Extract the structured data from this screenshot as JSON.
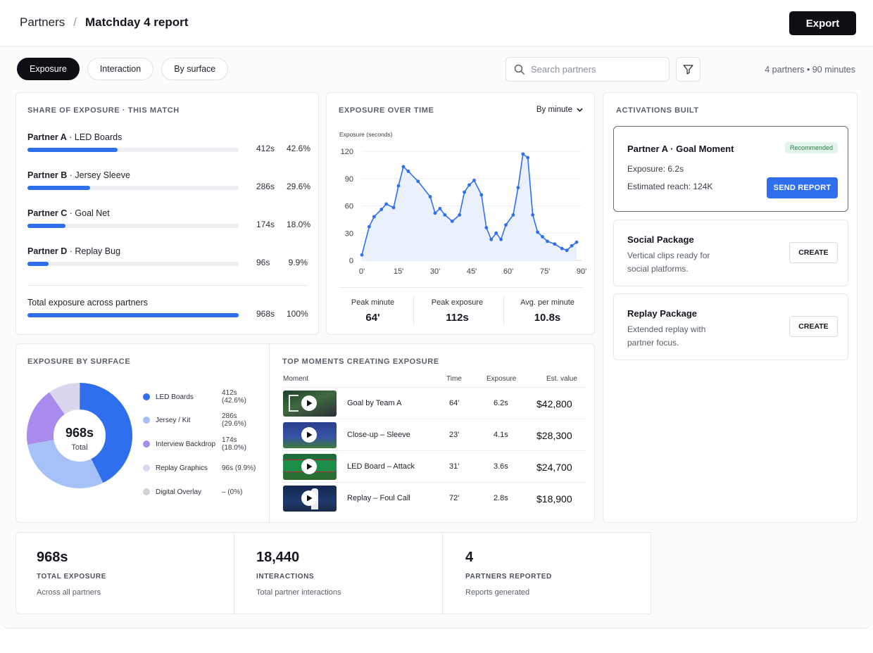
{
  "header": {
    "breadcrumb_root": "Partners",
    "breadcrumb_sep": "/",
    "breadcrumb_current": "Matchday 4 report",
    "export_label": "Export"
  },
  "toolbar": {
    "tabs": [
      {
        "label": "Exposure",
        "active": true
      },
      {
        "label": "Interaction",
        "active": false
      },
      {
        "label": "By surface",
        "active": false
      }
    ],
    "search_placeholder": "Search partners",
    "summary": "4 partners • 90 minutes"
  },
  "share": {
    "title": "Share of exposure · This match",
    "rows": [
      {
        "partner": "Partner A",
        "surface": "LED Boards",
        "seconds": "412s",
        "pct": "42.6%",
        "fraction": 0.426
      },
      {
        "partner": "Partner B",
        "surface": "Jersey Sleeve",
        "seconds": "286s",
        "pct": "29.6%",
        "fraction": 0.296
      },
      {
        "partner": "Partner C",
        "surface": "Goal Net",
        "seconds": "174s",
        "pct": "18.0%",
        "fraction": 0.18
      },
      {
        "partner": "Partner D",
        "surface": "Replay Bug",
        "seconds": "96s",
        "pct": "9.9%",
        "fraction": 0.099
      }
    ],
    "total_label": "Total exposure across partners",
    "total_seconds": "968s",
    "total_pct": "100%",
    "total_fraction": 1.0
  },
  "timeline": {
    "title": "Exposure over time",
    "granularity": "By minute",
    "stats": [
      {
        "label": "Peak minute",
        "value": "64'"
      },
      {
        "label": "Peak exposure",
        "value": "112s"
      },
      {
        "label": "Avg. per minute",
        "value": "10.8s"
      }
    ]
  },
  "chart_data": {
    "type": "area",
    "ylabel": "Exposure (seconds)",
    "xlabel": "",
    "x_ticks": [
      "0'",
      "15'",
      "30'",
      "45'",
      "60'",
      "75'",
      "90'"
    ],
    "y_ticks": [
      "0",
      "30",
      "60",
      "90",
      "120"
    ],
    "xlim": [
      0,
      90
    ],
    "ylim": [
      0,
      120
    ],
    "grid": true,
    "color": "#2f6fed",
    "fill": "#e8effd",
    "series": [
      {
        "x": [
          0,
          3,
          5,
          8,
          10,
          13,
          15,
          17,
          19,
          23,
          28,
          30,
          32,
          34,
          37,
          40,
          42,
          44,
          46,
          49,
          51,
          53,
          55,
          57,
          59,
          62,
          64,
          66,
          68,
          70,
          72,
          74,
          76,
          79,
          82,
          84,
          86,
          88
        ],
        "values": [
          6,
          37,
          48,
          56,
          62,
          58,
          82,
          103,
          98,
          87,
          70,
          52,
          57,
          50,
          43,
          50,
          75,
          83,
          88,
          72,
          36,
          23,
          30,
          23,
          39,
          50,
          80,
          117,
          113,
          50,
          31,
          26,
          21,
          18,
          13,
          11,
          16,
          20
        ]
      }
    ]
  },
  "activations": {
    "title": "Activations built",
    "featured": {
      "title": "Partner A · Goal Moment",
      "badge": "Recommended",
      "exposure": "Exposure: 6.2s",
      "reach": "Estimated reach: 124K",
      "action": "SEND REPORT"
    },
    "items": [
      {
        "title": "Social Package",
        "desc1": "Vertical clips ready for",
        "desc2": "social platforms.",
        "action": "CREATE"
      },
      {
        "title": "Replay Package",
        "desc1": "Extended replay with",
        "desc2": "partner focus.",
        "action": "CREATE"
      }
    ]
  },
  "surface": {
    "title": "Exposure by surface",
    "center_value": "968s",
    "center_label": "Total",
    "legend": [
      {
        "name": "LED Boards",
        "value": "412s (42.6%)",
        "color": "#2f6fed",
        "fraction": 0.426
      },
      {
        "name": "Jersey / Kit",
        "value": "286s (29.6%)",
        "color": "#a6c1f7",
        "fraction": 0.296
      },
      {
        "name": "Interview Backdrop",
        "value": "174s (18.0%)",
        "color": "#a88bec",
        "fraction": 0.18
      },
      {
        "name": "Replay Graphics",
        "value": "96s (9.9%)",
        "color": "#d9d6ee",
        "fraction": 0.099
      },
      {
        "name": "Digital Overlay",
        "value": "– (0%)",
        "color": "#cfd2d8",
        "fraction": 0.0
      }
    ]
  },
  "moments": {
    "title": "Top moments creating exposure",
    "columns": [
      "Moment",
      "Time",
      "Exposure",
      "Est. value"
    ],
    "rows": [
      {
        "name": "Goal by Team A",
        "time": "64'",
        "exposure": "6.2s",
        "value": "$42,800"
      },
      {
        "name": "Close-up – Sleeve",
        "time": "23'",
        "exposure": "4.1s",
        "value": "$28,300"
      },
      {
        "name": "LED Board – Attack",
        "time": "31'",
        "exposure": "3.6s",
        "value": "$24,700"
      },
      {
        "name": "Replay – Foul Call",
        "time": "72'",
        "exposure": "2.8s",
        "value": "$18,900"
      }
    ]
  },
  "kpis": [
    {
      "value": "968s",
      "label": "TOTAL EXPOSURE",
      "sub": "Across all partners"
    },
    {
      "value": "18,440",
      "label": "INTERACTIONS",
      "sub": "Total partner interactions"
    },
    {
      "value": "4",
      "label": "PARTNERS REPORTED",
      "sub": "Reports generated"
    }
  ]
}
